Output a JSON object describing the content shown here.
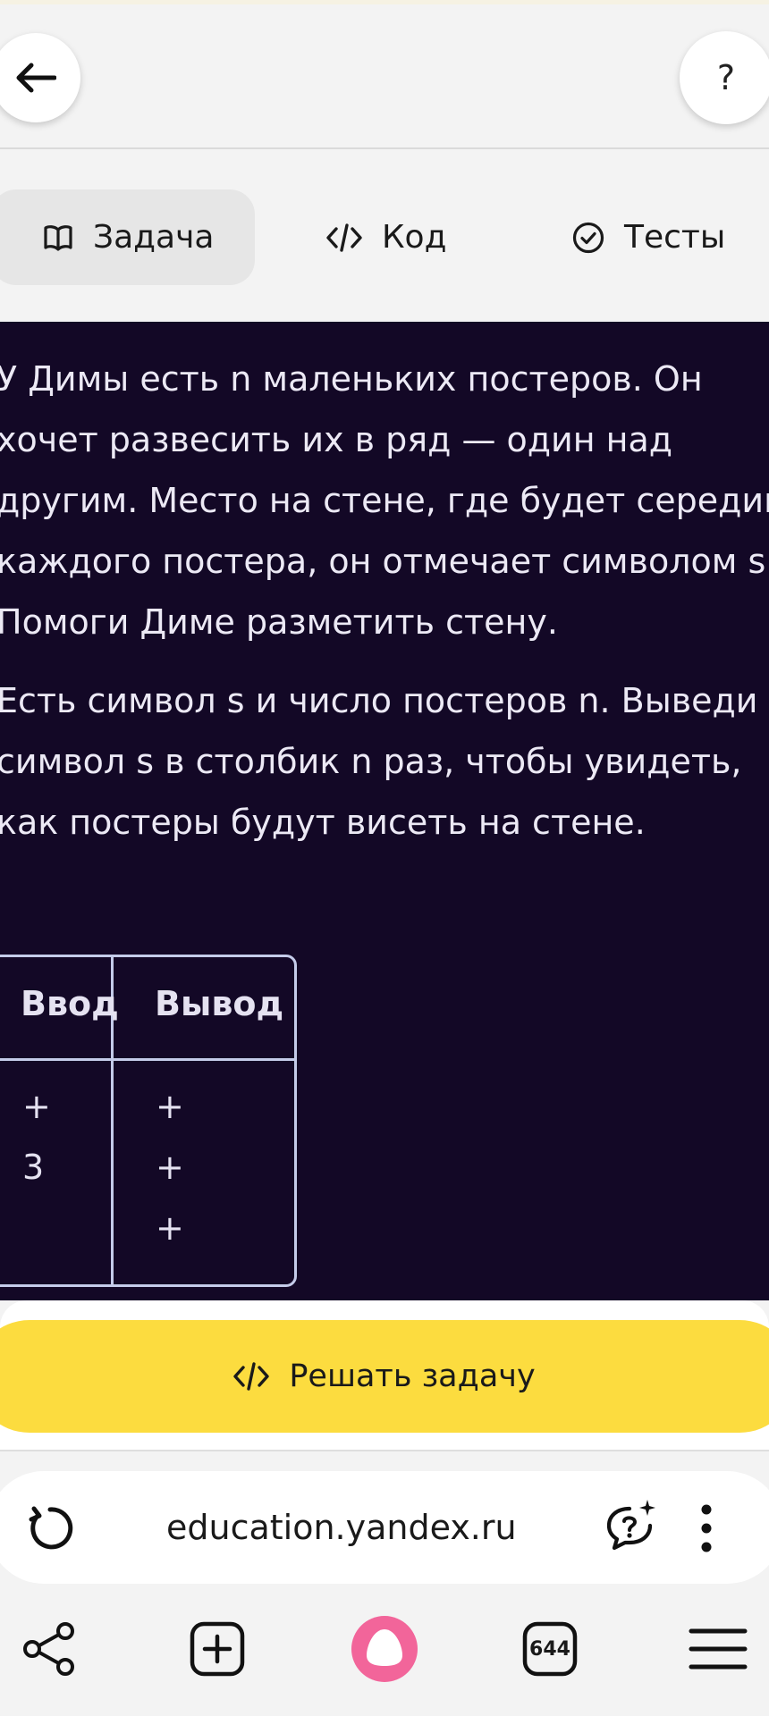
{
  "header": {
    "help_label": "?"
  },
  "tabs": [
    {
      "label": "Задача",
      "icon": "book-icon",
      "active": true
    },
    {
      "label": "Код",
      "icon": "code-icon",
      "active": false
    },
    {
      "label": "Тесты",
      "icon": "check-circle-icon",
      "active": false
    }
  ],
  "task": {
    "paragraph1": [
      "У Димы есть n маленьких постеров. Он",
      "хочет развесить их в ряд — один над",
      "другим. Место на стене, где будет середина",
      "каждого постера, он отмечает символом s.",
      "Помоги Диме разметить стену."
    ],
    "paragraph2": [
      "Есть символ s и число постеров n. Выведи",
      "символ s в столбик n раз, чтобы увидеть,",
      "как постеры будут висеть на стене."
    ]
  },
  "example": {
    "headers": [
      "Ввод",
      "Вывод"
    ],
    "input": [
      "+",
      "3"
    ],
    "output": [
      "+",
      "+",
      "+"
    ]
  },
  "solve_button": {
    "label": "Решать задачу"
  },
  "browser": {
    "url": "education.yandex.ru",
    "tabs_count": "644"
  },
  "colors": {
    "content_bg": "#130826",
    "accent_button": "#fcdc3f",
    "alice_button": "#f2659a"
  }
}
